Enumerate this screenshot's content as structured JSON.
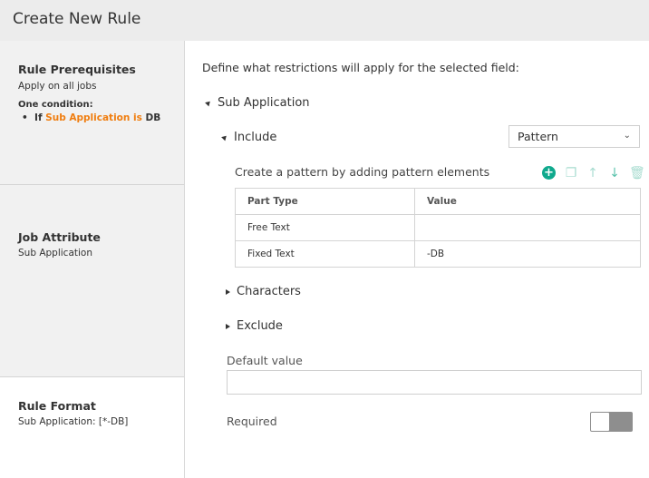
{
  "header": {
    "title": "Create New Rule"
  },
  "sidebar": {
    "prerequisites": {
      "heading": "Rule Prerequisites",
      "scope": "Apply on all jobs",
      "condition_heading": "One condition:",
      "condition_if": "If",
      "condition_field": "Sub Application is",
      "condition_value": "DB"
    },
    "job_attribute": {
      "heading": "Job Attribute",
      "value": "Sub Application"
    },
    "rule_format": {
      "heading": "Rule Format",
      "value": "Sub Application: [*-DB]"
    }
  },
  "main": {
    "intro": "Define what restrictions will apply for the selected field:",
    "section_title": "Sub Application",
    "include": {
      "label": "Include",
      "type_select": {
        "selected": "Pattern"
      },
      "hint": "Create a pattern by adding pattern elements",
      "table": {
        "columns": [
          "Part Type",
          "Value"
        ],
        "rows": [
          {
            "part_type": "Free Text",
            "value": ""
          },
          {
            "part_type": "Fixed Text",
            "value": "-DB"
          }
        ]
      }
    },
    "characters_label": "Characters",
    "exclude_label": "Exclude",
    "default_value": {
      "label": "Default value",
      "value": ""
    },
    "required": {
      "label": "Required",
      "checked": false
    }
  }
}
